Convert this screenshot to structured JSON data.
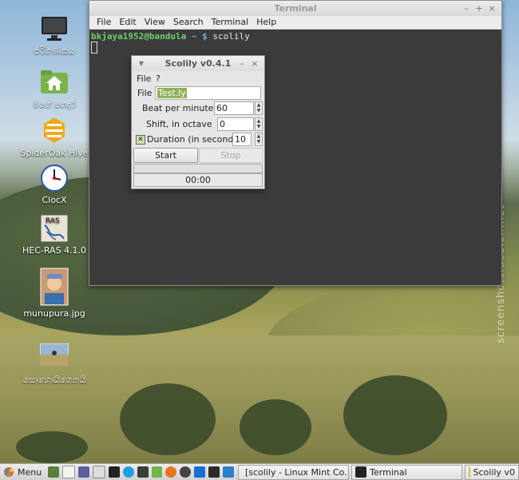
{
  "desktop": {
    "icons": [
      {
        "label": "පරිගණකය",
        "icon": "computer-icon"
      },
      {
        "label": "මගේ ගෙදර",
        "icon": "home-folder-icon"
      },
      {
        "label": "SpiderOak Hive",
        "icon": "spideroak-icon"
      },
      {
        "label": "ClocX",
        "icon": "clock-icon"
      },
      {
        "label": "HEC-RAS 4.1.0",
        "icon": "hec-ras-icon"
      },
      {
        "label": "munupura.jpg",
        "icon": "photo-icon"
      },
      {
        "label": "සොහොයිගෙනයි",
        "icon": "photo-icon"
      }
    ],
    "watermark": "screenshots.debian.net"
  },
  "terminal": {
    "title": "Terminal",
    "menu": [
      "File",
      "Edit",
      "View",
      "Search",
      "Terminal",
      "Help"
    ],
    "prompt_user": "bkjaya1952@bandula",
    "prompt_path": "~ $",
    "command": "scolily"
  },
  "scolily": {
    "title": "Scolily v0.4.1",
    "menu": [
      "File",
      "?"
    ],
    "file_label": "File",
    "file_value": "Test.ly",
    "bpm_label": "Beat per minute",
    "bpm_value": "60",
    "shift_label": "Shift, in octave",
    "shift_value": "0",
    "duration_label": "Duration (in seconds) :",
    "duration_value": "10",
    "duration_checked": true,
    "start_label": "Start",
    "stop_label": "Stop",
    "time": "00:00",
    "progress": 0
  },
  "taskbar": {
    "menu_label": "Menu",
    "tasks": [
      {
        "label": "[scolily - Linux Mint Co...",
        "icon": "browser-icon"
      },
      {
        "label": "Terminal",
        "icon": "terminal-icon"
      },
      {
        "label": "Scolily v0",
        "icon": "scolily-icon"
      }
    ]
  }
}
